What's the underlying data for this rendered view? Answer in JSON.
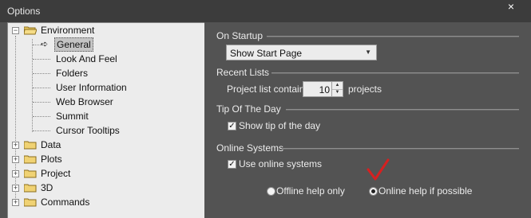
{
  "window": {
    "title": "Options",
    "close_symbol": "×"
  },
  "tree": {
    "root": {
      "label": "Environment",
      "expander": "−"
    },
    "children": [
      {
        "label": "General",
        "selected": true
      },
      {
        "label": "Look And Feel"
      },
      {
        "label": "Folders"
      },
      {
        "label": "User Information"
      },
      {
        "label": "Web Browser"
      },
      {
        "label": "Summit"
      },
      {
        "label": "Cursor Tooltips"
      }
    ],
    "collapsed": [
      {
        "label": "Data",
        "expander": "+"
      },
      {
        "label": "Plots",
        "expander": "+"
      },
      {
        "label": "Project",
        "expander": "+"
      },
      {
        "label": "3D",
        "expander": "+"
      },
      {
        "label": "Commands",
        "expander": "+"
      }
    ]
  },
  "settings": {
    "on_startup": {
      "heading": "On Startup",
      "dropdown_value": "Show Start Page",
      "caret": "▼"
    },
    "recent_lists": {
      "heading": "Recent Lists",
      "prefix": "Project list contains",
      "value": "10",
      "suffix": "projects",
      "up": "▲",
      "down": "▼"
    },
    "tip_of_day": {
      "heading": "Tip Of The Day",
      "checkbox_label": "Show tip of the day",
      "checked": true,
      "check_mark": "✓"
    },
    "online_systems": {
      "heading": "Online Systems",
      "checkbox_label": "Use online systems",
      "checked": true,
      "check_mark": "✓",
      "radio_offline": "Offline help only",
      "radio_online": "Online help if possible",
      "selected_radio": "online"
    }
  },
  "colors": {
    "annotation": "#d62020",
    "panel_bg": "#535353",
    "tree_bg": "#ececec"
  }
}
